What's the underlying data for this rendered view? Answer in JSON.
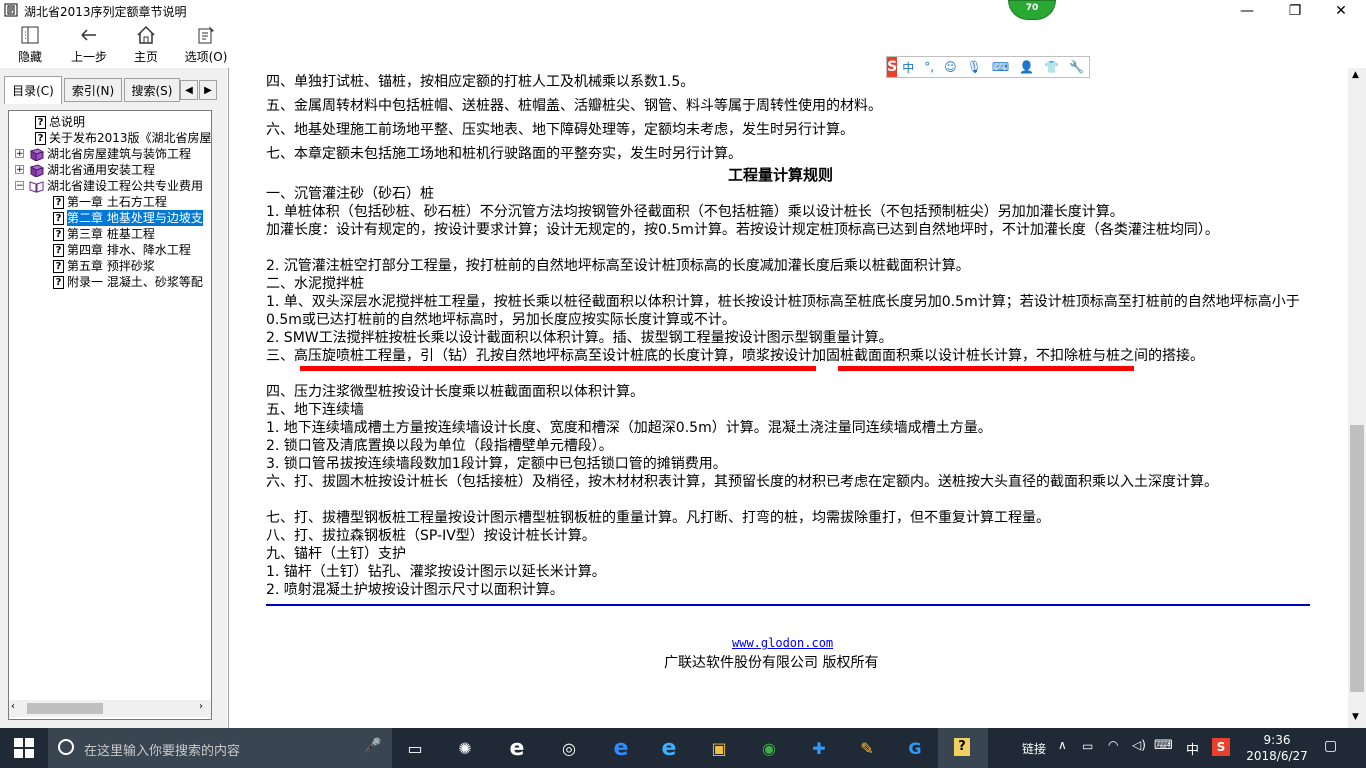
{
  "window": {
    "title": "湖北省2013序列定额章节说明",
    "badge": "70",
    "minimize": "—",
    "restore": "❐",
    "close": "✕"
  },
  "toolbar": {
    "hide": "隐藏",
    "back": "上一步",
    "home": "主页",
    "options": "选项(O)"
  },
  "tabs": {
    "contents": "目录(C)",
    "index": "索引(N)",
    "search": "搜索(S)"
  },
  "tree": [
    {
      "label": "总说明",
      "type": "page",
      "indent": 1
    },
    {
      "label": "关于发布2013版《湖北省房屋",
      "type": "page",
      "indent": 1
    },
    {
      "label": "湖北省房屋建筑与装饰工程",
      "type": "book",
      "indent": 0,
      "expander": "+"
    },
    {
      "label": "湖北省通用安装工程",
      "type": "book",
      "indent": 0,
      "expander": "+"
    },
    {
      "label": "湖北省建设工程公共专业费用",
      "type": "openbook",
      "indent": 0,
      "expander": "−"
    },
    {
      "label": "第一章  土石方工程",
      "type": "page",
      "indent": 2
    },
    {
      "label": "第二章  地基处理与边坡支",
      "type": "page",
      "indent": 2,
      "selected": true
    },
    {
      "label": "第三章  桩基工程",
      "type": "page",
      "indent": 2
    },
    {
      "label": "第四章  排水、降水工程",
      "type": "page",
      "indent": 2
    },
    {
      "label": "第五章  预拌砂浆",
      "type": "page",
      "indent": 2
    },
    {
      "label": "附录一  混凝土、砂浆等配",
      "type": "page",
      "indent": 2
    }
  ],
  "content": {
    "lines": [
      "四、单独打试桩、锚桩，按相应定额的打桩人工及机械乘以系数1.5。",
      "五、金属周转材料中包括桩帽、送桩器、桩帽盖、活瓣桩尖、钢管、料斗等属于周转性使用的材料。",
      "六、地基处理施工前场地平整、压实地表、地下障碍处理等，定额均未考虑，发生时另行计算。",
      "七、本章定额未包括施工场地和桩机行驶路面的平整夯实，发生时另行计算。"
    ],
    "heading": "工程量计算规则",
    "rules": [
      "一、沉管灌注砂（砂石）桩",
      "1. 单桩体积（包括砂桩、砂石桩）不分沉管方法均按钢管外径截面积（不包括桩箍）乘以设计桩长（不包括预制桩尖）另加加灌长度计算。",
      "加灌长度：设计有规定的，按设计要求计算；设计无规定的，按0.5m计算。若按设计规定桩顶标高已达到自然地坪时，不计加灌长度（各类灌注桩均同）。",
      "2. 沉管灌注桩空打部分工程量，按打桩前的自然地坪标高至设计桩顶标高的长度减加灌长度后乘以桩截面积计算。",
      "二、水泥搅拌桩",
      "1. 单、双头深层水泥搅拌桩工程量，按桩长乘以桩径截面积以体积计算，桩长按设计桩顶标高至桩底长度另加0.5m计算；若设计桩顶标高至打桩前的自然地坪标高小于0.5m或已达打桩前的自然地坪标高时，另加长度应按实际长度计算或不计。",
      "2. SMW工法搅拌桩按桩长乘以设计截面积以体积计算。插、拔型钢工程量按设计图示型钢重量计算。",
      "三、高压旋喷桩工程量，引（钻）孔按自然地坪标高至设计桩底的长度计算，喷浆按设计加固桩截面面积乘以设计桩长计算，不扣除桩与桩之间的搭接。",
      "四、压力注浆微型桩按设计长度乘以桩截面面积以体积计算。",
      "五、地下连续墙",
      "1. 地下连续墙成槽土方量按连续墙设计长度、宽度和槽深（加超深0.5m）计算。混凝土浇注量同连续墙成槽土方量。",
      "2. 锁口管及清底置换以段为单位（段指槽壁单元槽段）。",
      "3. 锁口管吊拔按连续墙段数加1段计算，定额中已包括锁口管的摊销费用。",
      "六、打、拔圆木桩按设计桩长（包括接桩）及梢径，按木材材积表计算，其预留长度的材积已考虑在定额内。送桩按大头直径的截面积乘以入土深度计算。",
      "七、打、拔槽型钢板桩工程量按设计图示槽型桩钢板桩的重量计算。凡打断、打弯的桩，均需拔除重打，但不重复计算工程量。",
      "八、打、拔拉森钢板桩（SP-IV型）按设计桩长计算。",
      "九、锚杆（土钉）支护",
      "1. 锚杆（土钉）钻孔、灌浆按设计图示以延长米计算。",
      "2. 喷射混凝土护坡按设计图示尺寸以面积计算。"
    ],
    "link": "www.glodon.com",
    "copyright": "广联达软件股份有限公司 版权所有"
  },
  "ime": {
    "lang": "中",
    "punct": "°,"
  },
  "taskbar": {
    "search_placeholder": "在这里输入你要搜索的内容",
    "links": "链接",
    "ime_lang": "中",
    "time": "9:36",
    "date": "2018/6/27"
  }
}
